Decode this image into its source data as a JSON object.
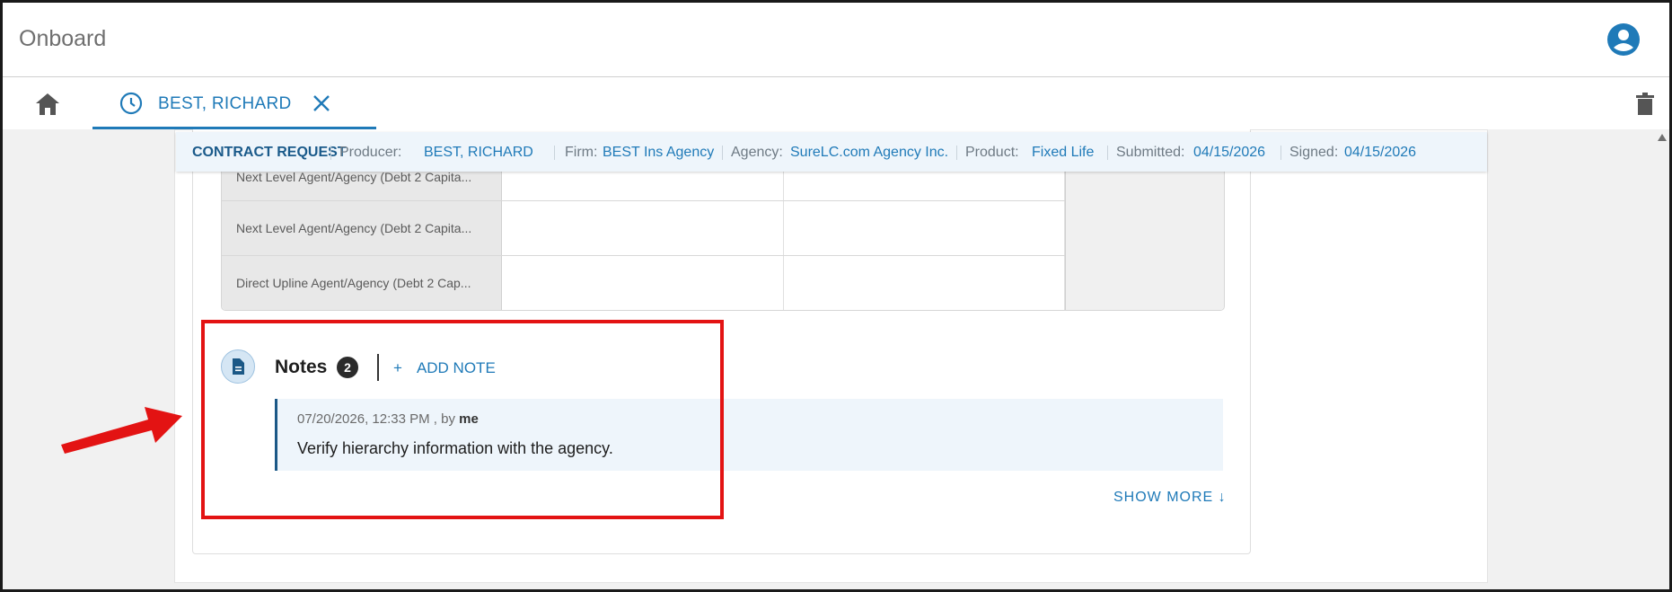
{
  "app": {
    "title": "Onboard"
  },
  "tab": {
    "label": "BEST, RICHARD"
  },
  "contract_bar": {
    "heading": "CONTRACT REQUEST",
    "producer_label": "Producer:",
    "producer_value": "BEST, RICHARD",
    "firm_label": "Firm:",
    "firm_value": "BEST Ins Agency",
    "agency_label": "Agency:",
    "agency_value": "SureLC.com Agency Inc.",
    "product_label": "Product:",
    "product_value": "Fixed Life",
    "submitted_label": "Submitted:",
    "submitted_value": "04/15/2026",
    "signed_label": "Signed:",
    "signed_value": "04/15/2026"
  },
  "hierarchy": {
    "rows": [
      {
        "label": "Next Level Agent/Agency (Debt 2 Capita..."
      },
      {
        "label": "Next Level Agent/Agency (Debt 2 Capita..."
      },
      {
        "label": "Direct Upline Agent/Agency (Debt 2 Cap..."
      }
    ]
  },
  "notes": {
    "title": "Notes",
    "count": "2",
    "add_plus": "+",
    "add_label": "ADD NOTE",
    "entry": {
      "timestamp": "07/20/2026, 12:33 PM",
      "by_prefix": ", by",
      "author": "me",
      "text": "Verify hierarchy information with the agency."
    },
    "show_more": "SHOW MORE ↓"
  },
  "colors": {
    "accent": "#1f7ab8",
    "highlight": "#e31313",
    "note_bg": "#eef5fb"
  },
  "icons": [
    "account-circle-icon",
    "home-icon",
    "clock-icon",
    "close-icon",
    "trash-icon",
    "document-icon",
    "scroll-up-icon"
  ]
}
